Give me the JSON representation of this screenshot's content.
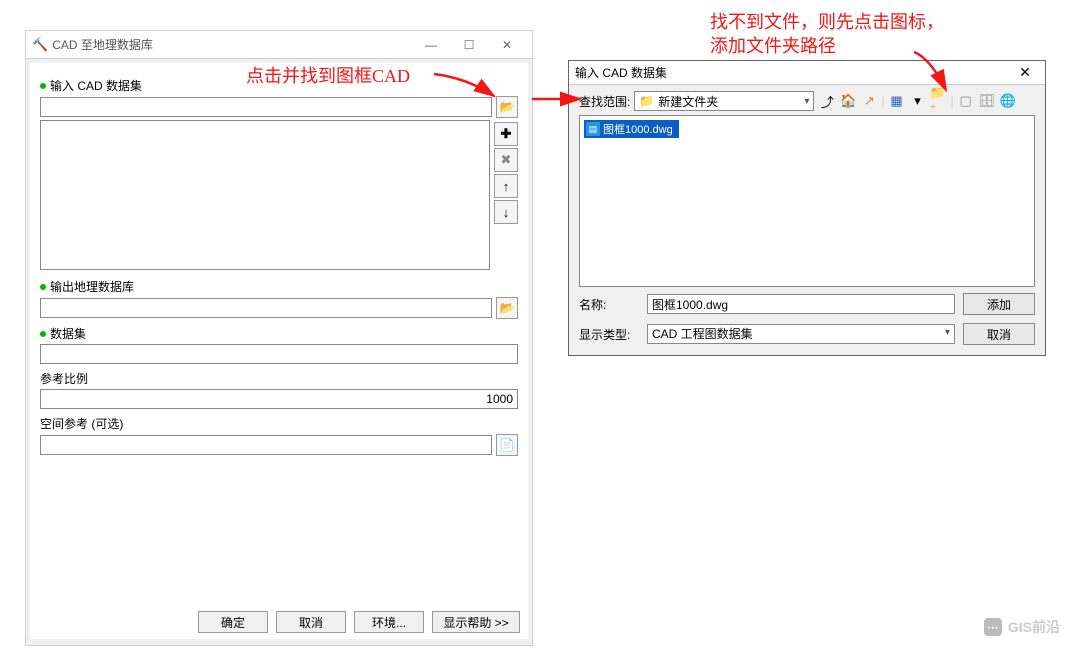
{
  "dialog1": {
    "title": "CAD 至地理数据库",
    "labels": {
      "input_cad": "输入 CAD 数据集",
      "output_gdb": "输出地理数据库",
      "dataset": "数据集",
      "scale": "参考比例",
      "spatial_ref": "空间参考 (可选)"
    },
    "scale_value": "1000",
    "buttons": {
      "ok": "确定",
      "cancel": "取消",
      "env": "环境...",
      "help": "显示帮助 >>"
    }
  },
  "dialog2": {
    "title": "输入 CAD 数据集",
    "search_label": "查找范围:",
    "folder_name": "新建文件夹",
    "file_name_label": "名称:",
    "file_name_value": "图框1000.dwg",
    "type_label": "显示类型:",
    "type_value": "CAD 工程图数据集",
    "list_item": "图框1000.dwg",
    "buttons": {
      "add": "添加",
      "cancel": "取消"
    }
  },
  "annotations": {
    "anno1": "点击并找到图框CAD",
    "anno2a": "找不到文件，则先点击图标，",
    "anno2b": "添加文件夹路径"
  },
  "watermark": "GIS前沿"
}
